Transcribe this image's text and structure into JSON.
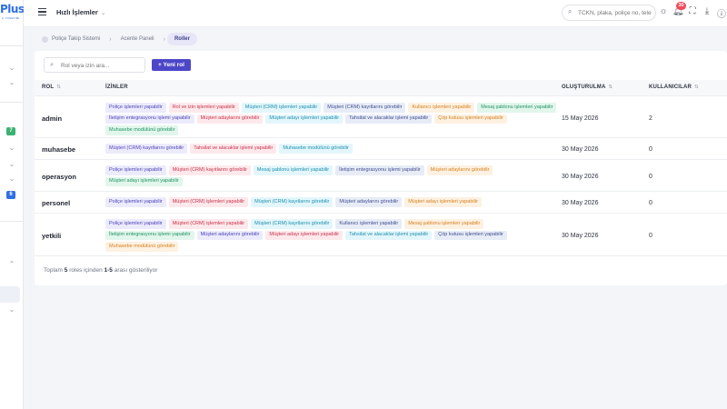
{
  "logo": {
    "text": "Plus",
    "sub": "C YÖNETİMİ"
  },
  "sidebar": {
    "badges": [
      {
        "text": "7",
        "color": "#3bb273"
      },
      {
        "text": "6",
        "color": "#2f6fe3"
      }
    ]
  },
  "topbar": {
    "quick_label": "Hızlı İşlemler",
    "search_placeholder": "TCKN, plaka, poliçe no, tele",
    "notification_count": "30"
  },
  "breadcrumb": {
    "items": [
      "Poliçe Takip Sistemi",
      "Acente Paneli",
      "Roller"
    ]
  },
  "toolbar": {
    "search_placeholder": "Rol veya izin ara...",
    "new_role_label": "+  Yeni rol"
  },
  "table": {
    "columns": {
      "role": "ROL",
      "permissions": "İZİNLER",
      "created": "OLUŞTURULMA",
      "users": "KULLANICILAR"
    },
    "rows": [
      {
        "role": "admin",
        "created": "15 May 2026",
        "users": "2",
        "permissions": [
          {
            "label": "Poliçe işlemleri yapabilir",
            "color": "purple"
          },
          {
            "label": "Rol ve izin işlemleri yapabilir",
            "color": "red"
          },
          {
            "label": "Müşteri (CRM) işlemleri yapabilir",
            "color": "cyan"
          },
          {
            "label": "Müşteri (CRM) kayıtlarını görebilir",
            "color": "indigo"
          },
          {
            "label": "Kullanıcı işlemleri yapabilir",
            "color": "orange"
          },
          {
            "label": "Mesaj şablonu işlemleri yapabilir",
            "color": "green"
          },
          {
            "label": "İletişim entegrasyonu işlemi yapabilir",
            "color": "purple"
          },
          {
            "label": "Müşteri adaylarını görebilir",
            "color": "red"
          },
          {
            "label": "Müşteri adayı işlemleri yapabilir",
            "color": "cyan"
          },
          {
            "label": "Tahsilat ve alacaklar işlemi yapabilir",
            "color": "indigo"
          },
          {
            "label": "Çöp kutusu işlemleri yapabilir",
            "color": "orange"
          },
          {
            "label": "Muhasebe modülünü görebilir",
            "color": "green"
          }
        ]
      },
      {
        "role": "muhasebe",
        "created": "30 May 2026",
        "users": "0",
        "permissions": [
          {
            "label": "Müşteri (CRM) kayıtlarını görebilir",
            "color": "purple"
          },
          {
            "label": "Tahsilat ve alacaklar işlemi yapabilir",
            "color": "red"
          },
          {
            "label": "Muhasebe modülünü görebilir",
            "color": "cyan"
          }
        ]
      },
      {
        "role": "operasyon",
        "created": "30 May 2026",
        "users": "0",
        "permissions": [
          {
            "label": "Poliçe işlemleri yapabilir",
            "color": "purple"
          },
          {
            "label": "Müşteri (CRM) kayıtlarını görebilir",
            "color": "red"
          },
          {
            "label": "Mesaj şablonu işlemleri yapabilir",
            "color": "cyan"
          },
          {
            "label": "İletişim entegrasyonu işlemi yapabilir",
            "color": "indigo"
          },
          {
            "label": "Müşteri adaylarını görebilir",
            "color": "orange"
          },
          {
            "label": "Müşteri adayı işlemleri yapabilir",
            "color": "green"
          }
        ]
      },
      {
        "role": "personel",
        "created": "30 May 2026",
        "users": "0",
        "permissions": [
          {
            "label": "Poliçe işlemleri yapabilir",
            "color": "purple"
          },
          {
            "label": "Müşteri (CRM) işlemleri yapabilir",
            "color": "red"
          },
          {
            "label": "Müşteri (CRM) kayıtlarını görebilir",
            "color": "cyan"
          },
          {
            "label": "Müşteri adaylarını görebilir",
            "color": "indigo"
          },
          {
            "label": "Müşteri adayı işlemleri yapabilir",
            "color": "orange"
          }
        ]
      },
      {
        "role": "yetkili",
        "created": "30 May 2026",
        "users": "0",
        "permissions": [
          {
            "label": "Poliçe işlemleri yapabilir",
            "color": "purple"
          },
          {
            "label": "Müşteri (CRM) işlemleri yapabilir",
            "color": "red"
          },
          {
            "label": "Müşteri (CRM) kayıtlarını görebilir",
            "color": "cyan"
          },
          {
            "label": "Kullanıcı işlemleri yapabilir",
            "color": "indigo"
          },
          {
            "label": "Mesaj şablonu işlemleri yapabilir",
            "color": "orange"
          },
          {
            "label": "İletişim entegrasyonu işlemi yapabilir",
            "color": "green"
          },
          {
            "label": "Müşteri adaylarını görebilir",
            "color": "purple"
          },
          {
            "label": "Müşteri adayı işlemleri yapabilir",
            "color": "red"
          },
          {
            "label": "Tahsilat ve alacaklar işlemi yapabilir",
            "color": "cyan"
          },
          {
            "label": "Çöp kutusu işlemleri yapabilir",
            "color": "indigo"
          },
          {
            "label": "Muhasebe modülünü görebilir",
            "color": "orange"
          }
        ]
      }
    ]
  },
  "footer": {
    "prefix": "Toplam",
    "total": "5",
    "middle": "roles içinden",
    "range": "1-5",
    "suffix": "arası gösteriliyor"
  }
}
